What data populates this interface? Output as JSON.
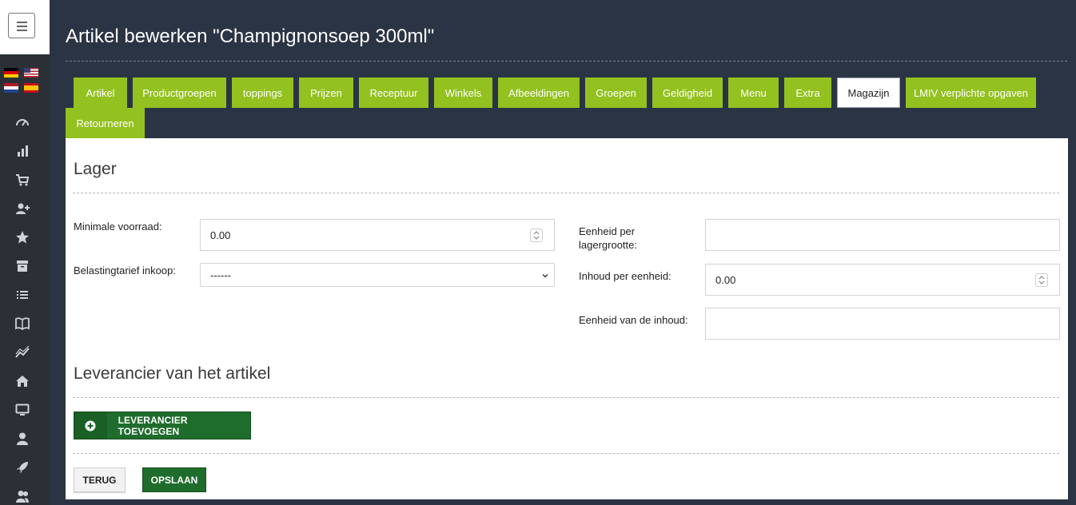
{
  "page": {
    "title": "Artikel bewerken \"Champignonsoep 300ml\""
  },
  "sidebar": {
    "languages": [
      "Deutsch",
      "English",
      "Nederlands",
      "Español"
    ],
    "icons": [
      "dashboard-icon",
      "bar-chart-icon",
      "cart-icon",
      "user-plus-icon",
      "star-icon",
      "archive-icon",
      "list-icon",
      "book-icon",
      "trend-icon",
      "home-icon",
      "monitor-icon",
      "user-icon",
      "rocket-icon",
      "users-icon"
    ]
  },
  "tabs": [
    {
      "label": "Artikel"
    },
    {
      "label": "Productgroepen"
    },
    {
      "label": "toppings"
    },
    {
      "label": "Prijzen"
    },
    {
      "label": "Receptuur"
    },
    {
      "label": "Winkels"
    },
    {
      "label": "Afbeeldingen"
    },
    {
      "label": "Groepen"
    },
    {
      "label": "Geldigheid"
    },
    {
      "label": "Menu"
    },
    {
      "label": "Extra"
    },
    {
      "label": "Magazijn",
      "active": true
    },
    {
      "label": "LMIV verplichte opgaven"
    },
    {
      "label": "Retourneren"
    }
  ],
  "lager": {
    "title": "Lager",
    "min_stock_label": "Minimale voorraad:",
    "min_stock_value": "0.00",
    "tax_label": "Belastingtarief inkoop:",
    "tax_value": "------",
    "unit_per_size_label_1": "Eenheid per",
    "unit_per_size_label_2": "lagergrootte:",
    "unit_per_size_value": "",
    "content_per_unit_label": "Inhoud per eenheid:",
    "content_per_unit_value": "0.00",
    "content_unit_label": "Eenheid van de inhoud:",
    "content_unit_value": ""
  },
  "supplier": {
    "title": "Leverancier van het artikel",
    "add_button": "LEVERANCIER TOEVOEGEN"
  },
  "actions": {
    "back": "TERUG",
    "save": "OPSLAAN"
  },
  "colors": {
    "tab_green": "#93c11f",
    "button_green": "#1f6d2c",
    "header_bg": "#2b3444",
    "sidebar_bg": "#2b3036"
  }
}
